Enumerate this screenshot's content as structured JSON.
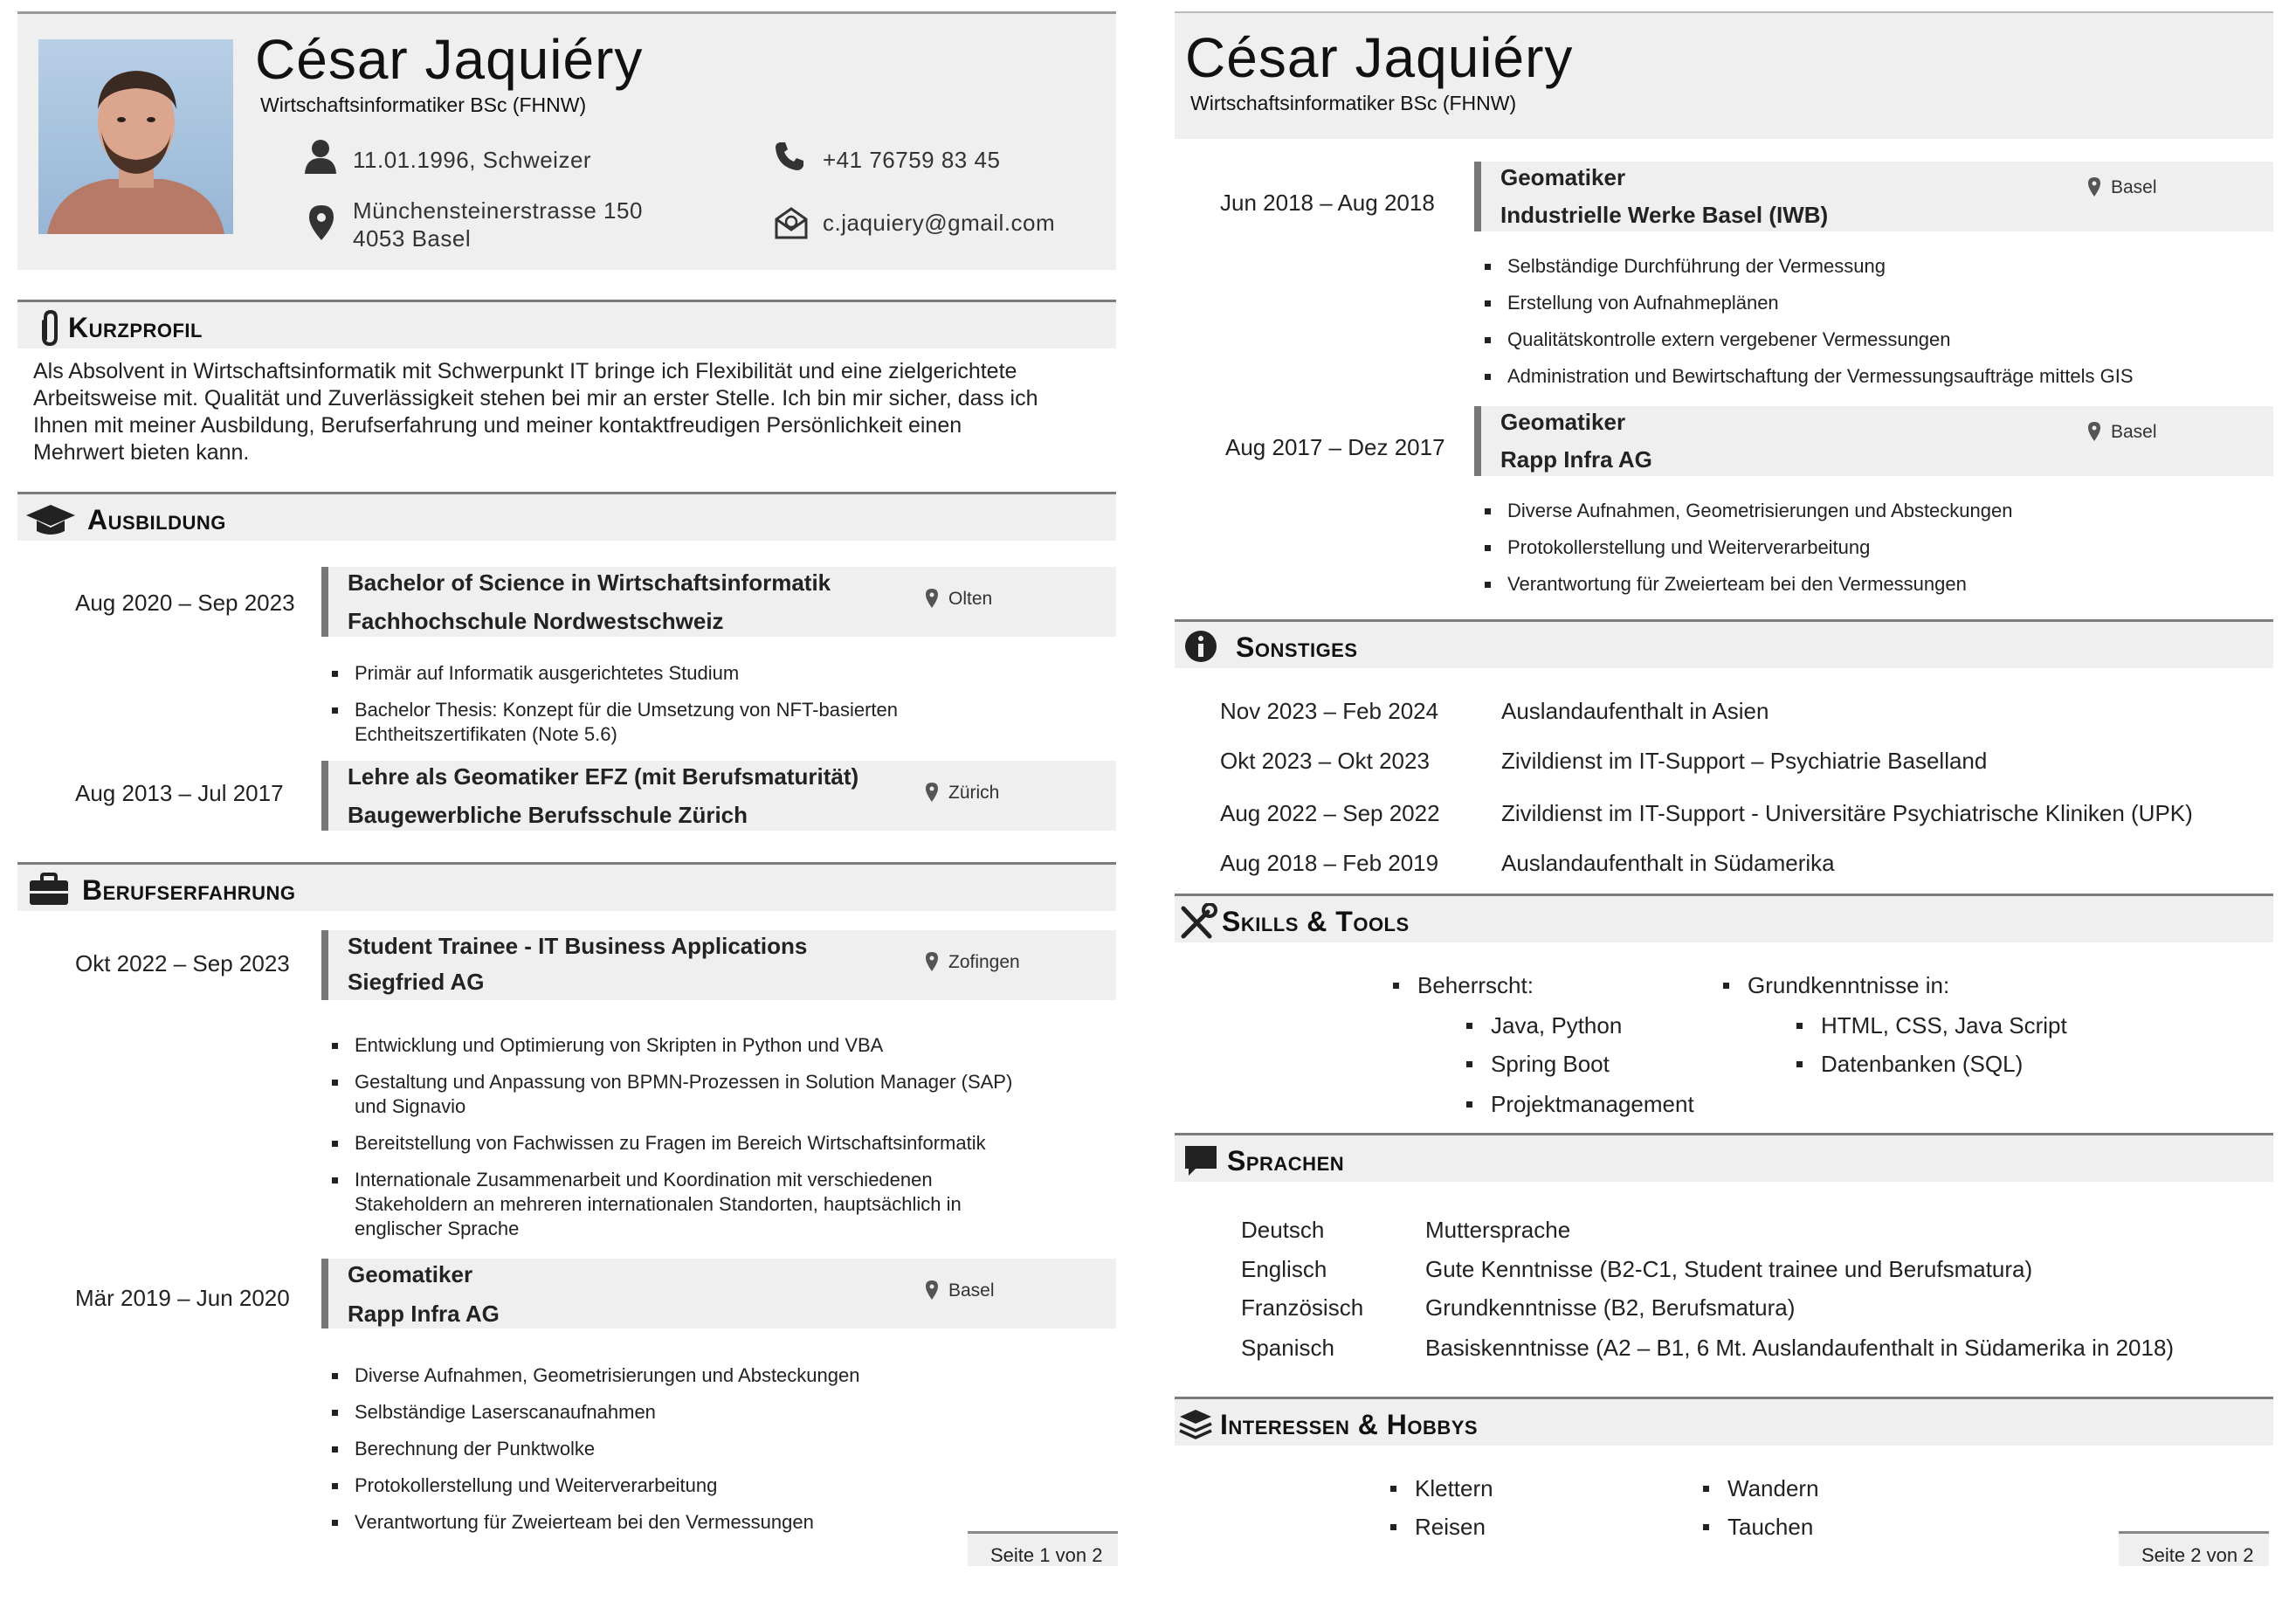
{
  "page1": {
    "header": {
      "name": "César Jaquiéry",
      "subtitle": "Wirtschaftsinformatiker BSc (FHNW)",
      "birth_nationality": "11.01.1996, Schweizer",
      "phone": "+41 76759 83 45",
      "address_line1": "Münchensteinerstrasse 150",
      "address_line2": "4053 Basel",
      "email": "c.jaquiery@gmail.com",
      "icons": [
        "person-icon",
        "phone-icon",
        "location-pin-icon",
        "email-icon"
      ]
    },
    "kurzprofil": {
      "heading": "Kurzprofil",
      "lines": [
        "Als Absolvent in Wirtschaftsinformatik mit Schwerpunkt IT bringe ich Flexibilität und eine zielgerichtete",
        "Arbeitsweise mit. Qualität und Zuverlässigkeit stehen bei mir an erster Stelle. Ich bin mir sicher, dass ich",
        "Ihnen mit meiner Ausbildung, Berufserfahrung und meiner kontaktfreudigen Persönlichkeit einen",
        "Mehrwert bieten kann."
      ]
    },
    "ausbildung": {
      "heading": "Ausbildung",
      "entries": [
        {
          "date": "Aug 2020 – Sep 2023",
          "title": "Bachelor of Science in Wirtschaftsinformatik",
          "org": "Fachhochschule Nordwestschweiz",
          "location": "Olten",
          "bullets": [
            [
              "Primär auf Informatik ausgerichtetes Studium"
            ],
            [
              "Bachelor Thesis: Konzept für die Umsetzung von NFT-basierten",
              "Echtheitszertifikaten (Note 5.6)"
            ]
          ]
        },
        {
          "date": "Aug 2013 – Jul 2017",
          "title": "Lehre als Geomatiker EFZ (mit Berufsmaturität)",
          "org": "Baugewerbliche Berufsschule Zürich",
          "location": "Zürich",
          "bullets": []
        }
      ]
    },
    "berufserfahrung": {
      "heading": "Berufserfahrung",
      "entries": [
        {
          "date": "Okt 2022 – Sep 2023",
          "title": "Student Trainee - IT Business Applications",
          "org": "Siegfried AG",
          "location": "Zofingen",
          "bullets": [
            [
              "Entwicklung und Optimierung von Skripten in Python und VBA"
            ],
            [
              "Gestaltung und Anpassung von BPMN-Prozessen in Solution Manager (SAP)",
              "und Signavio"
            ],
            [
              "Bereitstellung von Fachwissen zu Fragen im Bereich Wirtschaftsinformatik"
            ],
            [
              "Internationale Zusammenarbeit und Koordination mit verschiedenen",
              "Stakeholdern an mehreren internationalen Standorten, hauptsächlich in",
              "englischer Sprache"
            ]
          ]
        },
        {
          "date": "Mär 2019 – Jun 2020",
          "title": "Geomatiker",
          "org": "Rapp Infra AG",
          "location": "Basel",
          "bullets": [
            [
              "Diverse Aufnahmen, Geometrisierungen und Absteckungen"
            ],
            [
              "Selbständige Laserscanaufnahmen"
            ],
            [
              "Berechnung der Punktwolke"
            ],
            [
              "Protokollerstellung und Weiterverarbeitung"
            ],
            [
              "Verantwortung für Zweierteam bei den Vermessungen"
            ]
          ]
        }
      ]
    },
    "footer": "Seite 1 von 2"
  },
  "page2": {
    "header": {
      "name": "César Jaquiéry",
      "subtitle": "Wirtschaftsinformatiker BSc (FHNW)"
    },
    "experience": [
      {
        "date": "Jun 2018 – Aug 2018",
        "title": "Geomatiker",
        "org": "Industrielle Werke Basel (IWB)",
        "location": "Basel",
        "bullets": [
          "Selbständige Durchführung der Vermessung",
          "Erstellung von Aufnahmeplänen",
          "Qualitätskontrolle extern vergebener Vermessungen",
          "Administration und Bewirtschaftung der Vermessungsaufträge mittels GIS"
        ]
      },
      {
        "date": "Aug 2017 – Dez 2017",
        "title": "Geomatiker",
        "org": "Rapp Infra AG",
        "location": "Basel",
        "bullets": [
          "Diverse Aufnahmen, Geometrisierungen und Absteckungen",
          "Protokollerstellung und Weiterverarbeitung",
          "Verantwortung für Zweierteam bei den Vermessungen"
        ]
      }
    ],
    "sonstiges": {
      "heading": "Sonstiges",
      "rows": [
        {
          "date": "Nov 2023 – Feb 2024",
          "text": "Auslandaufenthalt in Asien"
        },
        {
          "date": "Okt 2023 – Okt 2023",
          "text": "Zivildienst im IT-Support – Psychiatrie Baselland"
        },
        {
          "date": "Aug 2022 – Sep 2022",
          "text": "Zivildienst im IT-Support - Universitäre Psychiatrische Kliniken (UPK)"
        },
        {
          "date": "Aug 2018 – Feb 2019",
          "text": "Auslandaufenthalt in Südamerika"
        }
      ]
    },
    "skills": {
      "heading": "Skills & Tools",
      "col1_label": "Beherrscht:",
      "col1_items": [
        "Java, Python",
        "Spring Boot",
        "Projektmanagement"
      ],
      "col2_label": "Grundkenntnisse in:",
      "col2_items": [
        "HTML, CSS, Java Script",
        "Datenbanken (SQL)"
      ]
    },
    "sprachen": {
      "heading": "Sprachen",
      "rows": [
        {
          "lang": "Deutsch",
          "level": "Muttersprache"
        },
        {
          "lang": "Englisch",
          "level": "Gute Kenntnisse (B2-C1, Student trainee und Berufsmatura)"
        },
        {
          "lang": "Französisch",
          "level": "Grundkenntnisse (B2, Berufsmatura)"
        },
        {
          "lang": "Spanisch",
          "level": "Basiskenntnisse (A2 – B1, 6 Mt. Auslandaufenthalt in Südamerika in 2018)"
        }
      ]
    },
    "interessen": {
      "heading": "Interessen & Hobbys",
      "col1": [
        "Klettern",
        "Reisen"
      ],
      "col2": [
        "Wandern",
        "Tauchen"
      ]
    },
    "footer": "Seite 2 von 2"
  }
}
